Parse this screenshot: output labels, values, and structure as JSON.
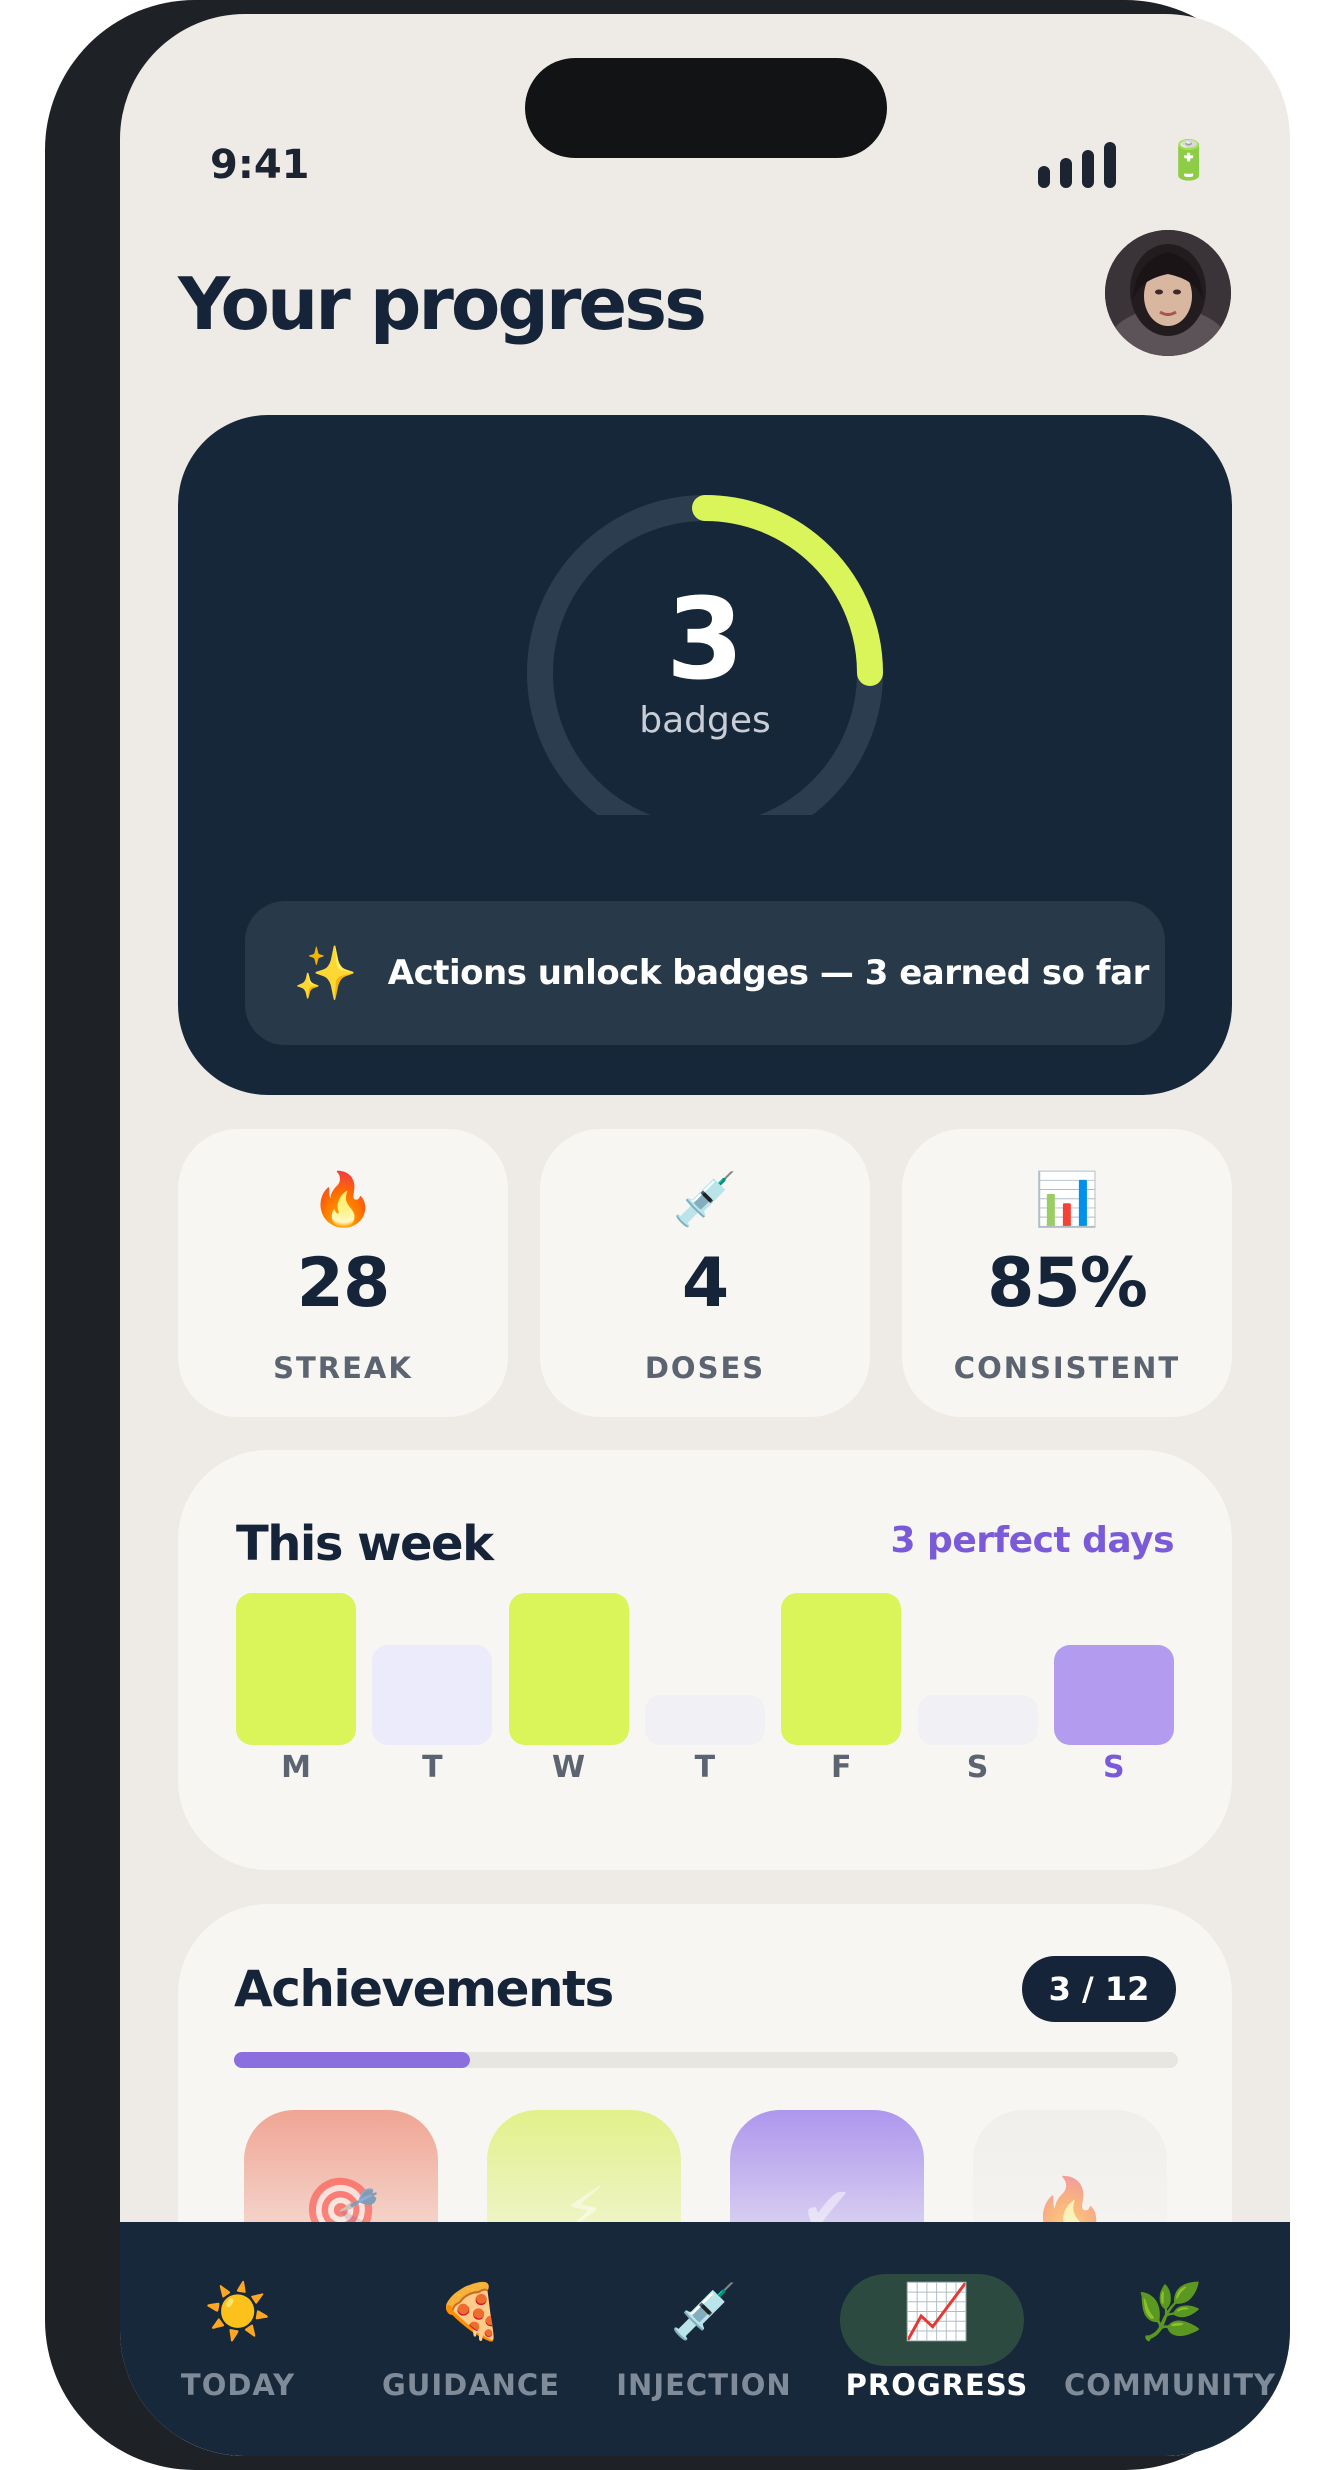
{
  "status_bar": {
    "time": "9:41"
  },
  "header": {
    "title": "Your progress"
  },
  "hero": {
    "badge_count": "3",
    "badge_unit": "badges",
    "ring_progress": 0.25,
    "note": "Actions unlock badges — 3 earned so far",
    "note_icon": "✨"
  },
  "stats": [
    {
      "icon": "🔥",
      "value": "28",
      "label": "STREAK"
    },
    {
      "icon": "💉",
      "value": "4",
      "label": "DOSES"
    },
    {
      "icon": "📊",
      "value": "85%",
      "label": "CONSISTENT"
    }
  ],
  "week": {
    "title": "This week",
    "summary": "3 perfect days",
    "days": [
      {
        "label": "M",
        "level": 1.0,
        "color": "#d9f55a"
      },
      {
        "label": "T",
        "level": 0.66,
        "color": "#ecebfb"
      },
      {
        "label": "W",
        "level": 1.0,
        "color": "#d9f55a"
      },
      {
        "label": "T",
        "level": 0.33,
        "color": "#f0f0f5"
      },
      {
        "label": "F",
        "level": 1.0,
        "color": "#d9f55a"
      },
      {
        "label": "S",
        "level": 0.33,
        "color": "#f0f0f5"
      },
      {
        "label": "S",
        "level": 0.66,
        "color": "#b39cf0",
        "today": true
      }
    ]
  },
  "achievements": {
    "title": "Achievements",
    "count": "3 / 12",
    "progress": 0.25,
    "tiles": [
      {
        "icon": "🎯",
        "colors": [
          "#f0a594",
          "#f7f6f2"
        ]
      },
      {
        "icon": "⚡",
        "colors": [
          "#e2f18a",
          "#f7f6f2"
        ]
      },
      {
        "icon": "✔",
        "colors": [
          "#ad97ee",
          "#f7f6f2"
        ]
      },
      {
        "icon": "🔥",
        "colors": [
          "#f1efeb",
          "#f7f6f2"
        ]
      }
    ]
  },
  "tabs": [
    {
      "icon": "☀️",
      "label": "TODAY"
    },
    {
      "icon": "🍕",
      "label": "GUIDANCE"
    },
    {
      "icon": "💉",
      "label": "INJECTION"
    },
    {
      "icon": "📈",
      "label": "PROGRESS",
      "active": true
    },
    {
      "icon": "🌿",
      "label": "COMMUNITY"
    }
  ],
  "colors": {
    "accent_lime": "#d9f55a",
    "accent_purple": "#7a5ad8",
    "navy": "#16243a"
  }
}
